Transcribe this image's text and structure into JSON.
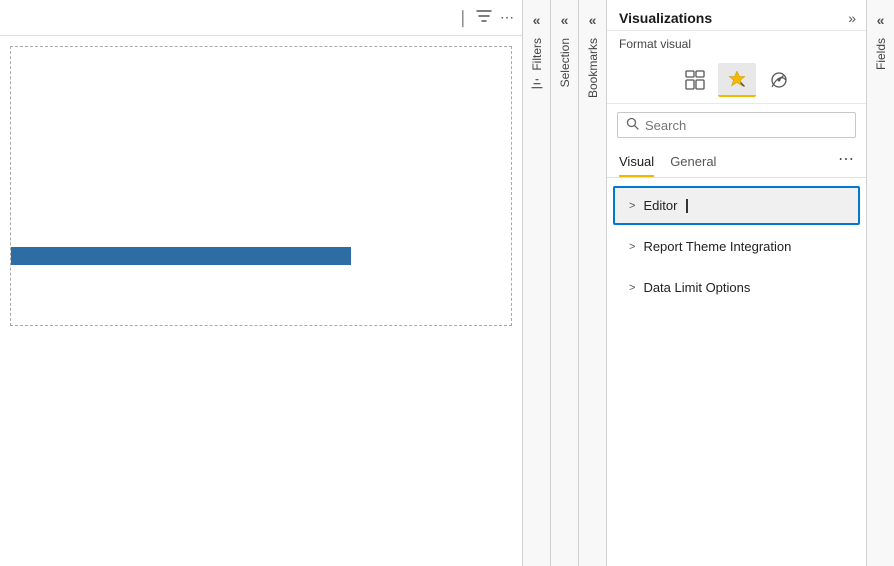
{
  "toolbar": {
    "cursor_icon": "cursor",
    "filter_icon": "filter",
    "more_icon": "more-options"
  },
  "panels": {
    "filters_label": "Filters",
    "selection_label": "Selection",
    "bookmarks_label": "Bookmarks",
    "fields_label": "Fields"
  },
  "visualizations": {
    "title": "Visualizations",
    "subtitle": "Format visual",
    "expand_icon": "»",
    "format_icons": [
      {
        "name": "build-visual-icon",
        "label": "Build visual",
        "active": false
      },
      {
        "name": "format-visual-icon",
        "label": "Format visual",
        "active": true
      },
      {
        "name": "analytics-icon",
        "label": "Analytics",
        "active": false
      }
    ],
    "search": {
      "placeholder": "Search",
      "icon": "search"
    },
    "tabs": [
      {
        "id": "visual",
        "label": "Visual",
        "active": true
      },
      {
        "id": "general",
        "label": "General",
        "active": false
      }
    ],
    "accordion_items": [
      {
        "id": "editor",
        "label": "Editor",
        "selected": true
      },
      {
        "id": "report-theme-integration",
        "label": "Report Theme Integration",
        "selected": false
      },
      {
        "id": "data-limit-options",
        "label": "Data Limit Options",
        "selected": false
      }
    ]
  }
}
